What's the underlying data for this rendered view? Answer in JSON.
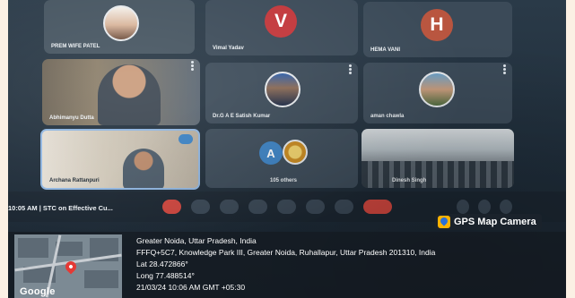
{
  "meeting": {
    "participants": [
      {
        "name": "PREM WIFE PATEL"
      },
      {
        "name": "Vimal Yadav",
        "initial": "V"
      },
      {
        "name": "HEMA VANI",
        "initial": "H"
      },
      {
        "name": "Abhimanyu Dutta"
      },
      {
        "name": "Dr.G A E Satish Kumar"
      },
      {
        "name": "aman chawla"
      },
      {
        "name": "Archana Rattanpuri"
      },
      {
        "name": "105 others",
        "initial": "A"
      },
      {
        "name": "Dinesh Singh"
      }
    ],
    "bottom_bar": {
      "clock_title": "10:05 AM  |  STC on Effective Cu..."
    },
    "colors": {
      "avatar_v": "#c2363a",
      "avatar_h": "#b9553f",
      "avatar_a": "#3b82c4",
      "end_call": "#d0473f"
    }
  },
  "gps": {
    "badge": "GPS Map Camera",
    "address_line1": "Greater Noida, Uttar Pradesh, India",
    "address_line2": "FFFQ+5C7, Knowledge Park III, Greater Noida, Ruhallapur, Uttar Pradesh 201310, India",
    "lat": "Lat 28.472866°",
    "long": "Long 77.488514°",
    "datetime": "21/03/24 10:06 AM GMT +05:30",
    "map_brand": "Google"
  }
}
